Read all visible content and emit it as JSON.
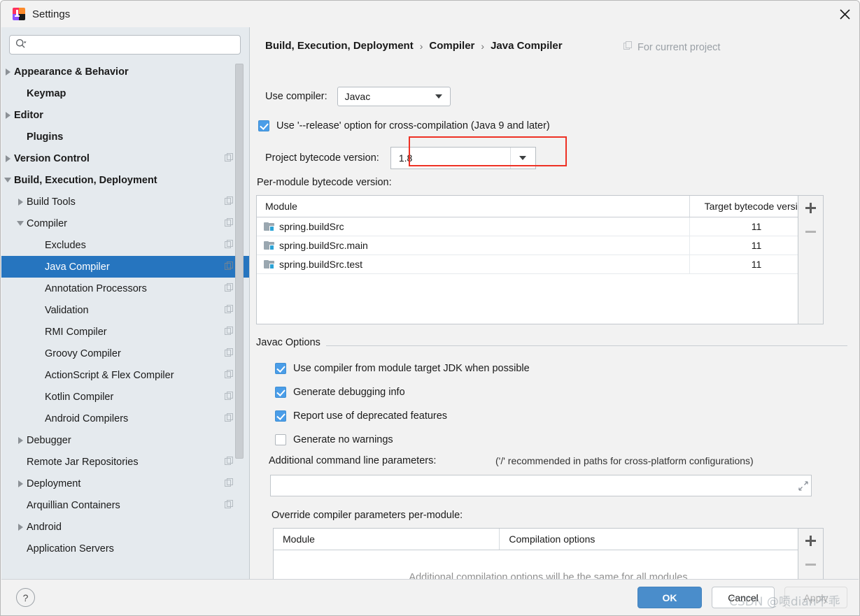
{
  "window": {
    "title": "Settings",
    "app_icon": "intellij-idea-icon",
    "close_icon": "close-icon"
  },
  "sidebar": {
    "search": {
      "placeholder": "",
      "value": "",
      "icon": "search-icon"
    },
    "items": [
      {
        "label": "Appearance & Behavior",
        "arrow": "right",
        "bold": true,
        "indent": 18,
        "copy": false,
        "selected": false
      },
      {
        "label": "Keymap",
        "arrow": "none",
        "bold": true,
        "indent": 36,
        "copy": false,
        "selected": false
      },
      {
        "label": "Editor",
        "arrow": "right",
        "bold": true,
        "indent": 18,
        "copy": false,
        "selected": false
      },
      {
        "label": "Plugins",
        "arrow": "none",
        "bold": true,
        "indent": 36,
        "copy": false,
        "selected": false
      },
      {
        "label": "Version Control",
        "arrow": "right",
        "bold": true,
        "indent": 18,
        "copy": true,
        "selected": false
      },
      {
        "label": "Build, Execution, Deployment",
        "arrow": "down",
        "bold": true,
        "indent": 18,
        "copy": false,
        "selected": false
      },
      {
        "label": "Build Tools",
        "arrow": "right",
        "bold": false,
        "indent": 36,
        "copy": true,
        "selected": false
      },
      {
        "label": "Compiler",
        "arrow": "down",
        "bold": false,
        "indent": 36,
        "copy": true,
        "selected": false
      },
      {
        "label": "Excludes",
        "arrow": "none",
        "bold": false,
        "indent": 62,
        "copy": true,
        "selected": false
      },
      {
        "label": "Java Compiler",
        "arrow": "none",
        "bold": false,
        "indent": 62,
        "copy": true,
        "selected": true
      },
      {
        "label": "Annotation Processors",
        "arrow": "none",
        "bold": false,
        "indent": 62,
        "copy": true,
        "selected": false
      },
      {
        "label": "Validation",
        "arrow": "none",
        "bold": false,
        "indent": 62,
        "copy": true,
        "selected": false
      },
      {
        "label": "RMI Compiler",
        "arrow": "none",
        "bold": false,
        "indent": 62,
        "copy": true,
        "selected": false
      },
      {
        "label": "Groovy Compiler",
        "arrow": "none",
        "bold": false,
        "indent": 62,
        "copy": true,
        "selected": false
      },
      {
        "label": "ActionScript & Flex Compiler",
        "arrow": "none",
        "bold": false,
        "indent": 62,
        "copy": true,
        "selected": false
      },
      {
        "label": "Kotlin Compiler",
        "arrow": "none",
        "bold": false,
        "indent": 62,
        "copy": true,
        "selected": false
      },
      {
        "label": "Android Compilers",
        "arrow": "none",
        "bold": false,
        "indent": 62,
        "copy": true,
        "selected": false
      },
      {
        "label": "Debugger",
        "arrow": "right",
        "bold": false,
        "indent": 36,
        "copy": false,
        "selected": false
      },
      {
        "label": "Remote Jar Repositories",
        "arrow": "none",
        "bold": false,
        "indent": 36,
        "copy": true,
        "selected": false
      },
      {
        "label": "Deployment",
        "arrow": "right",
        "bold": false,
        "indent": 36,
        "copy": true,
        "selected": false
      },
      {
        "label": "Arquillian Containers",
        "arrow": "none",
        "bold": false,
        "indent": 36,
        "copy": true,
        "selected": false
      },
      {
        "label": "Android",
        "arrow": "right",
        "bold": false,
        "indent": 36,
        "copy": false,
        "selected": false
      },
      {
        "label": "Application Servers",
        "arrow": "none",
        "bold": false,
        "indent": 36,
        "copy": false,
        "selected": false
      }
    ]
  },
  "main": {
    "breadcrumb": {
      "parts": [
        "Build, Execution, Deployment",
        "Compiler",
        "Java Compiler"
      ],
      "separator": "›"
    },
    "scope": {
      "label": "For current project",
      "icon": "copy-icon"
    },
    "use_compiler": {
      "label": "Use compiler:",
      "value": "Javac"
    },
    "release_option": {
      "label": "Use '--release' option for cross-compilation (Java 9 and later)",
      "checked": true
    },
    "project_bytecode": {
      "label": "Project bytecode version:",
      "value": "1.8",
      "highlight_color": "#ee3124"
    },
    "per_module": {
      "label": "Per-module bytecode version:",
      "columns": [
        "Module",
        "Target bytecode version"
      ],
      "rows": [
        {
          "module": "spring.buildSrc",
          "target": "11"
        },
        {
          "module": "spring.buildSrc.main",
          "target": "11"
        },
        {
          "module": "spring.buildSrc.test",
          "target": "11"
        }
      ],
      "add_label": "+",
      "remove_label": "−"
    },
    "javac_options": {
      "title": "Javac Options",
      "options": [
        {
          "label": "Use compiler from module target JDK when possible",
          "checked": true
        },
        {
          "label": "Generate debugging info",
          "checked": true
        },
        {
          "label": "Report use of deprecated features",
          "checked": true
        },
        {
          "label": "Generate no warnings",
          "checked": false
        }
      ],
      "params_label": "Additional command line parameters:",
      "params_hint": "('/' recommended in paths for cross-platform configurations)",
      "params_value": "",
      "params_placeholder": "",
      "expand_icon": "expand-icon"
    },
    "override": {
      "label": "Override compiler parameters per-module:",
      "columns": [
        "Module",
        "Compilation options"
      ],
      "empty_message": "Additional compilation options will be the same for all modules",
      "add_label": "+",
      "remove_label": "−"
    }
  },
  "footer": {
    "help_label": "?",
    "ok_label": "OK",
    "cancel_label": "Cancel",
    "apply_label": "Apply"
  },
  "watermark": {
    "text": "CSDN @唝dian不乖"
  },
  "colors": {
    "accent": "#2675bf",
    "ok_button": "#4a8dcb",
    "checkbox": "#4a9de8",
    "highlight": "#ee3124",
    "sidebar_bg": "#e5eaee"
  }
}
